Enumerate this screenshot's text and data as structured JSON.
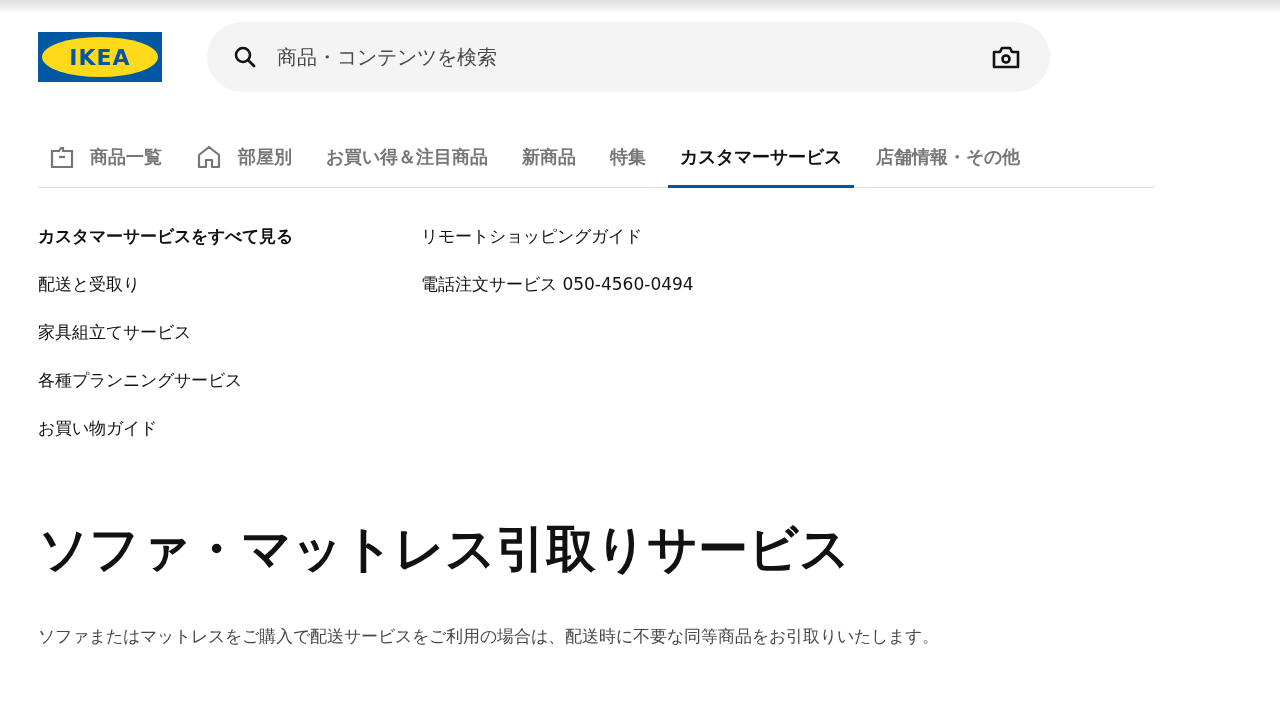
{
  "logo": {
    "text": "IKEA"
  },
  "search": {
    "placeholder": "商品・コンテンツを検索"
  },
  "tabs": [
    {
      "label": "商品一覧",
      "kind": "icon-tab",
      "selected": false
    },
    {
      "label": "部屋別",
      "kind": "icon-tab",
      "selected": false
    },
    {
      "label": "お買い得＆注目商品",
      "kind": "text-tab",
      "selected": false
    },
    {
      "label": "新商品",
      "kind": "text-tab",
      "selected": false
    },
    {
      "label": "特集",
      "kind": "text-tab",
      "selected": false
    },
    {
      "label": "カスタマーサービス",
      "kind": "text-tab",
      "selected": true
    },
    {
      "label": "店舗情報・その他",
      "kind": "text-tab",
      "selected": false
    }
  ],
  "menu": {
    "columns": [
      [
        {
          "label": "カスタマーサービスをすべて見る",
          "emphasized": true
        },
        {
          "label": "配送と受取り",
          "emphasized": false
        },
        {
          "label": "家具組立てサービス",
          "emphasized": false
        },
        {
          "label": "各種プランニングサービス",
          "emphasized": false
        },
        {
          "label": "お買い物ガイド",
          "emphasized": false
        }
      ],
      [
        {
          "label": "リモートショッピングガイド",
          "emphasized": false
        },
        {
          "label": "電話注文サービス 050-4560-0494",
          "emphasized": false
        }
      ]
    ]
  },
  "article": {
    "heading": "ソファ・マットレス引取りサービス",
    "body": "ソファまたはマットレスをご購入で配送サービスをご利用の場合は、配送時に不要な同等商品をお引取りいたします。"
  }
}
